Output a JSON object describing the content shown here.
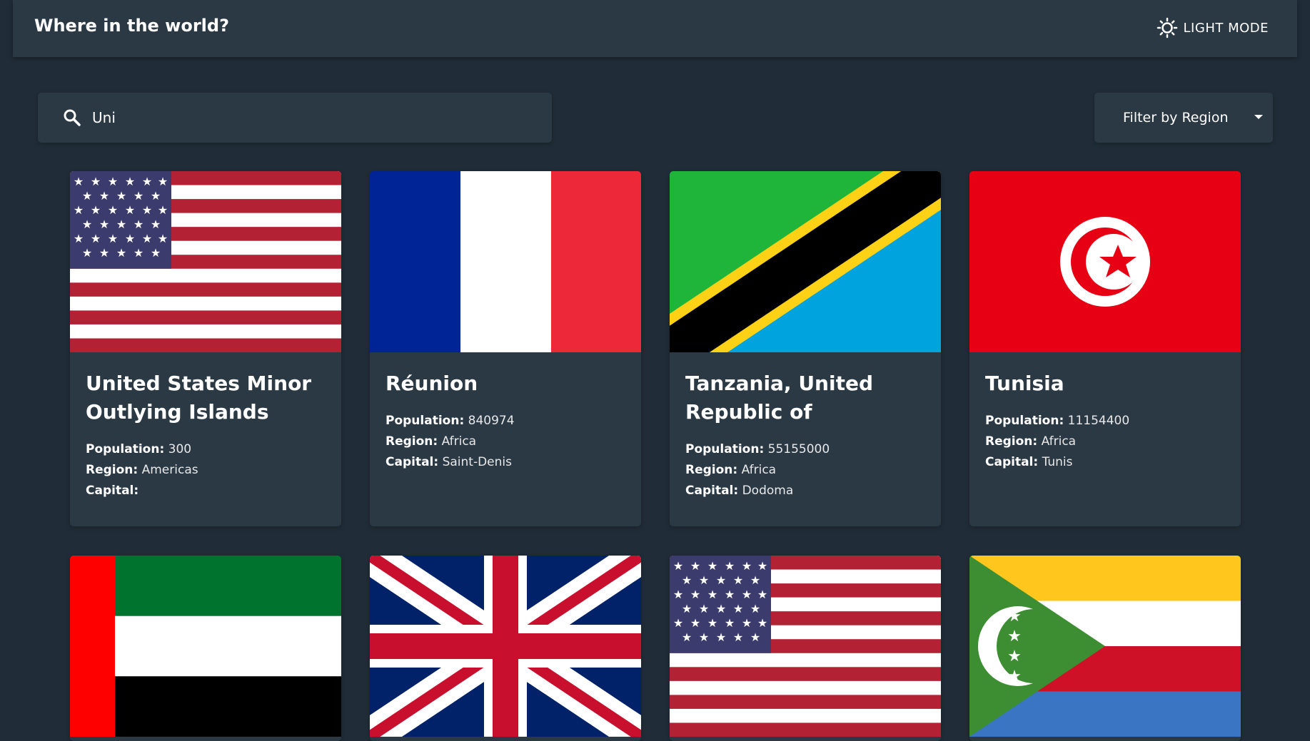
{
  "header": {
    "title": "Where in the world?",
    "mode_label": "LIGHT MODE",
    "mode_icon": "sun-icon"
  },
  "search": {
    "value": "Uni",
    "icon": "search-icon"
  },
  "filter": {
    "label": "Filter by Region",
    "icon": "chevron-down-icon"
  },
  "labels": {
    "population": "Population:",
    "region": "Region:",
    "capital": "Capital:"
  },
  "colors": {
    "background": "#202c37",
    "element": "#2b3945",
    "text": "#ffffff"
  },
  "countries": [
    {
      "name": "United States Minor Outlying Islands",
      "population": "300",
      "region": "Americas",
      "capital": ""
    },
    {
      "name": "Réunion",
      "population": "840974",
      "region": "Africa",
      "capital": "Saint-Denis"
    },
    {
      "name": "Tanzania, United Republic of",
      "population": "55155000",
      "region": "Africa",
      "capital": "Dodoma"
    },
    {
      "name": "Tunisia",
      "population": "11154400",
      "region": "Africa",
      "capital": "Tunis"
    },
    {
      "flag": "United Arab Emirates flag"
    },
    {
      "flag": "United Kingdom flag"
    },
    {
      "flag": "United States flag"
    },
    {
      "flag": "Comoros flag"
    }
  ]
}
